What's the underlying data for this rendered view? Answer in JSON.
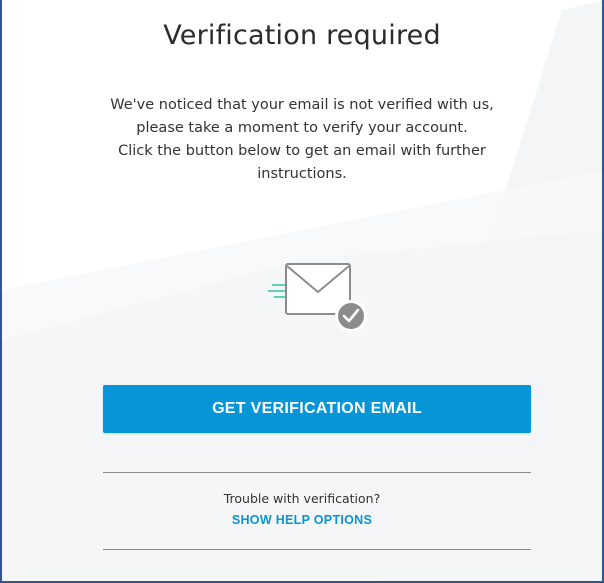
{
  "dialog": {
    "title": "Verification required",
    "description_lines": [
      "We've noticed that your email is not verified with us,",
      "please take a moment to verify your account.",
      "Click the button below to get an email with further",
      "instructions."
    ],
    "primary_button_label": "GET VERIFICATION EMAIL",
    "trouble_text": "Trouble with verification?",
    "help_link_label": "SHOW HELP OPTIONS"
  },
  "icons": {
    "illustration": "envelope-check-icon"
  },
  "colors": {
    "accent": "#0696d7",
    "text": "#333333",
    "icon_gray": "#8c8c8c",
    "speed_lines": "#2ec4a6",
    "frame_border": "#2f5597"
  }
}
